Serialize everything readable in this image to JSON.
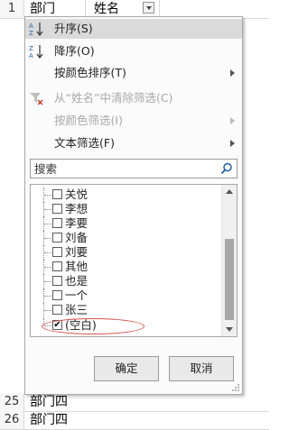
{
  "sheet": {
    "header_row": {
      "num": "1",
      "col_a": "部门",
      "col_b": "姓名"
    },
    "bottom_rows": [
      {
        "num": "25",
        "col_a": "部门四"
      },
      {
        "num": "26",
        "col_a": "部门四"
      }
    ]
  },
  "menu": {
    "items": [
      {
        "label": "升序(S)",
        "icon": "sort-ascending-icon",
        "highlighted": true,
        "disabled": false,
        "submenu": false
      },
      {
        "label": "降序(O)",
        "icon": "sort-descending-icon",
        "highlighted": false,
        "disabled": false,
        "submenu": false
      },
      {
        "label": "按颜色排序(T)",
        "icon": "",
        "highlighted": false,
        "disabled": false,
        "submenu": true
      },
      {
        "label": "从“姓名”中清除筛选(C)",
        "icon": "clear-filter-icon",
        "highlighted": false,
        "disabled": true,
        "submenu": false
      },
      {
        "label": "按颜色筛选(I)",
        "icon": "",
        "highlighted": false,
        "disabled": true,
        "submenu": true
      },
      {
        "label": "文本筛选(F)",
        "icon": "",
        "highlighted": false,
        "disabled": false,
        "submenu": true
      }
    ],
    "search": {
      "placeholder": "搜索",
      "icon": "magnifier-icon"
    },
    "list": [
      {
        "label": "关悦",
        "checked": false
      },
      {
        "label": "李想",
        "checked": false
      },
      {
        "label": "李要",
        "checked": false
      },
      {
        "label": "刘备",
        "checked": false
      },
      {
        "label": "刘要",
        "checked": false
      },
      {
        "label": "其他",
        "checked": false
      },
      {
        "label": "也是",
        "checked": false
      },
      {
        "label": "一个",
        "checked": false
      },
      {
        "label": "张三",
        "checked": false
      },
      {
        "label": "(空白)",
        "checked": true
      }
    ],
    "ok_label": "确定",
    "cancel_label": "取消"
  },
  "colors": {
    "highlight": "#dadada",
    "annotation": "#d9534f"
  }
}
